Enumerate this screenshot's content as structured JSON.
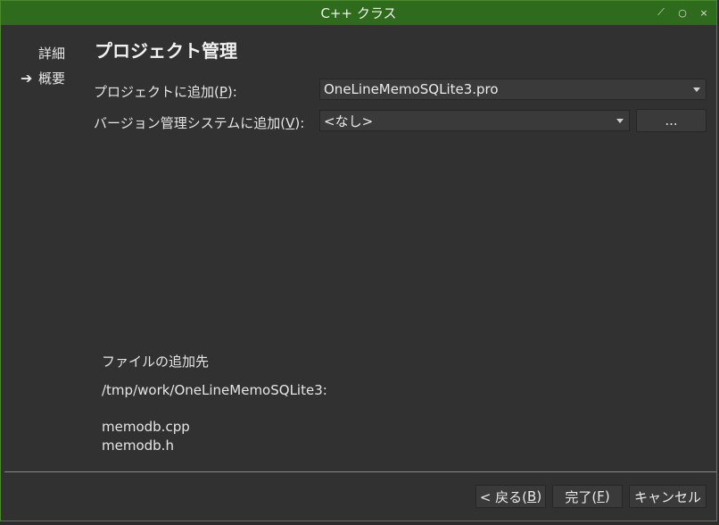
{
  "window": {
    "title": "C++ クラス",
    "controls": [
      "⟋",
      "○",
      "×"
    ]
  },
  "steps": [
    {
      "label": "詳細",
      "current": false
    },
    {
      "label": "概要",
      "current": true
    }
  ],
  "page_title": "プロジェクト管理",
  "add_to_project": {
    "label_prefix": "プロジェクトに追加(",
    "mnemonic": "P",
    "label_suffix": "):",
    "value": "OneLineMemoSQLite3.pro"
  },
  "add_to_vcs": {
    "label_prefix": "バージョン管理システムに追加(",
    "mnemonic": "V",
    "label_suffix": "):",
    "value": "<なし>",
    "config_button": "..."
  },
  "files": {
    "heading": "ファイルの追加先",
    "path": "/tmp/work/OneLineMemoSQLite3:",
    "list": [
      "memodb.cpp",
      "memodb.h"
    ]
  },
  "footer": {
    "back_prefix": "< 戻る(",
    "back_mnemonic": "B",
    "back_suffix": ")",
    "finish_prefix": "完了(",
    "finish_mnemonic": "F",
    "finish_suffix": ")",
    "cancel": "キャンセル"
  }
}
